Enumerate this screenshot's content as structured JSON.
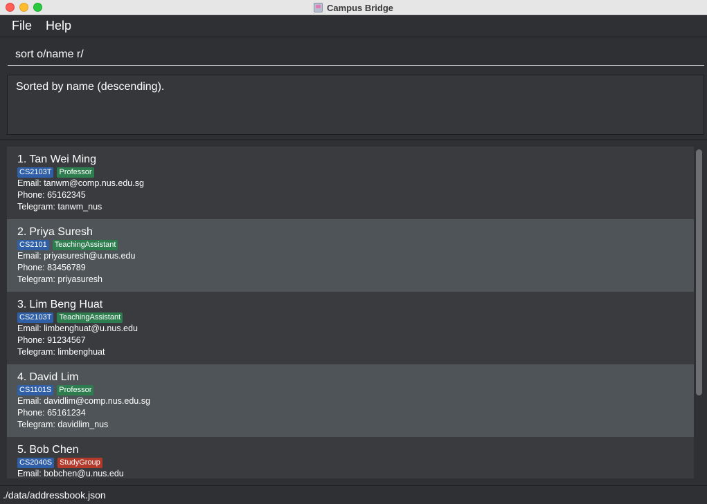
{
  "window": {
    "title": "Campus Bridge"
  },
  "menu": {
    "file": "File",
    "help": "Help"
  },
  "command": {
    "value": "sort o/name r/"
  },
  "result": {
    "message": "Sorted by name (descending)."
  },
  "contacts": [
    {
      "index": "1.",
      "name": "Tan Wei Ming",
      "tags": [
        "CS2103T",
        "Professor"
      ],
      "email": "Email: tanwm@comp.nus.edu.sg",
      "phone": "Phone: 65162345",
      "telegram": "Telegram: tanwm_nus"
    },
    {
      "index": "2.",
      "name": "Priya Suresh",
      "tags": [
        "CS2101",
        "TeachingAssistant"
      ],
      "email": "Email: priyasuresh@u.nus.edu",
      "phone": "Phone: 83456789",
      "telegram": "Telegram: priyasuresh"
    },
    {
      "index": "3.",
      "name": "Lim Beng Huat",
      "tags": [
        "CS2103T",
        "TeachingAssistant"
      ],
      "email": "Email: limbenghuat@u.nus.edu",
      "phone": "Phone: 91234567",
      "telegram": "Telegram: limbenghuat"
    },
    {
      "index": "4.",
      "name": "David Lim",
      "tags": [
        "CS1101S",
        "Professor"
      ],
      "email": "Email: davidlim@comp.nus.edu.sg",
      "phone": "Phone: 65161234",
      "telegram": "Telegram: davidlim_nus"
    },
    {
      "index": "5.",
      "name": "Bob Chen",
      "tags": [
        "CS2040S",
        "StudyGroup"
      ],
      "email": "Email: bobchen@u.nus.edu"
    }
  ],
  "status": {
    "path": "./data/addressbook.json"
  },
  "colors": {
    "module_tag": "#2f5fa6",
    "role_tag": "#2e7d4f",
    "group_tag": "#b33a2a",
    "background": "#2f3033"
  }
}
